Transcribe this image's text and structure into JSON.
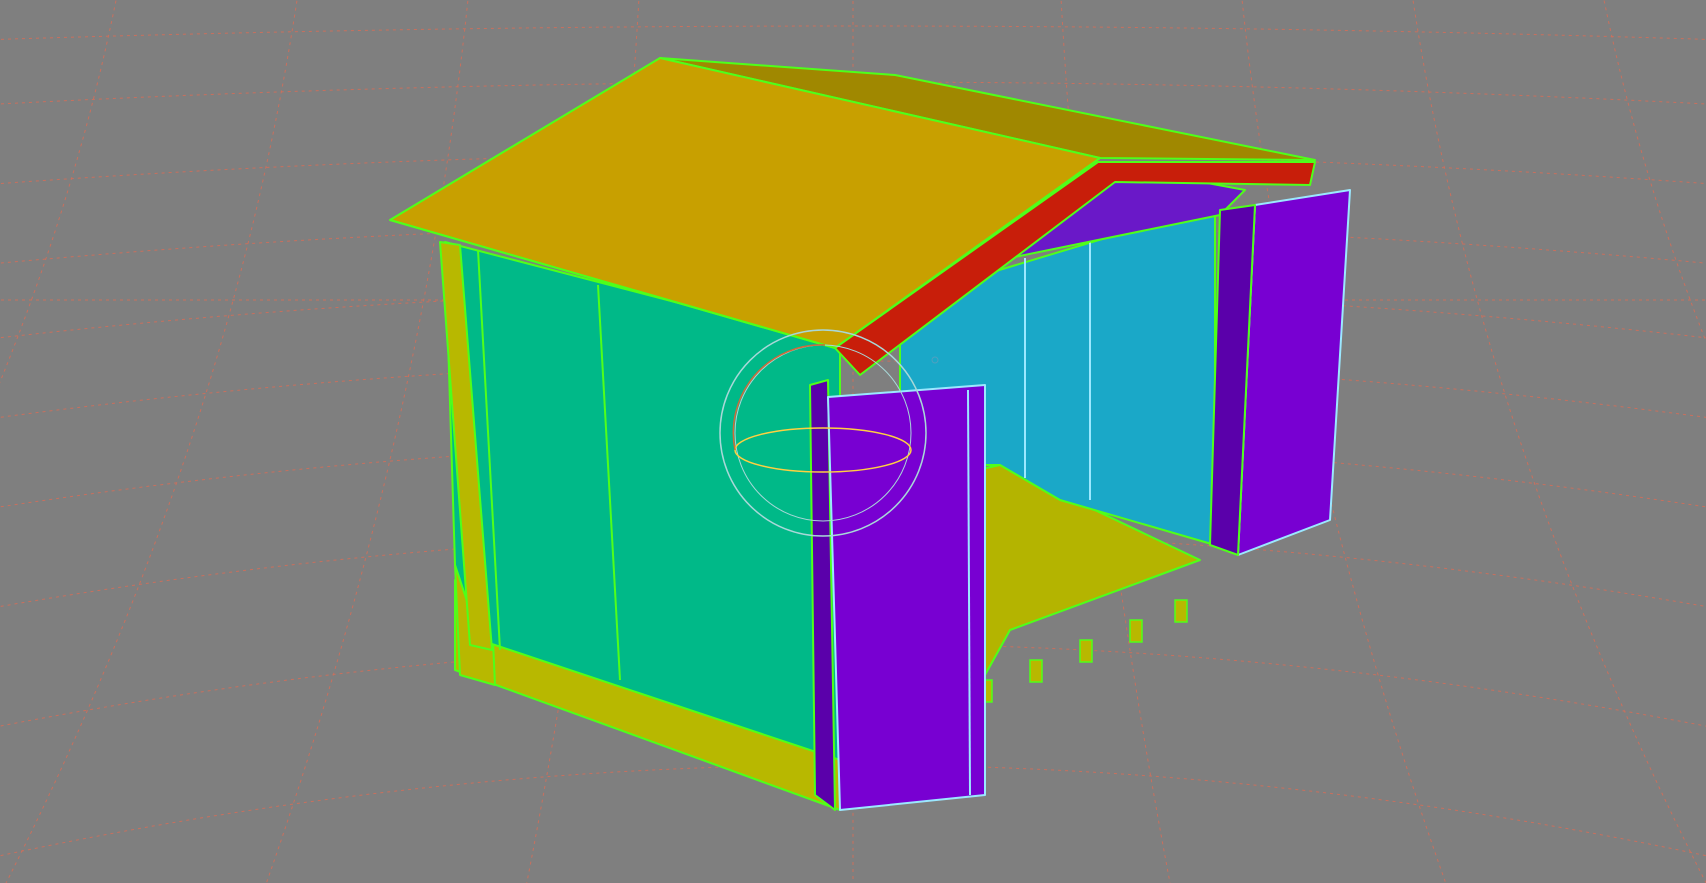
{
  "viewport": {
    "background": "#7f7f7f",
    "grid_color": "#c8705e"
  },
  "model": {
    "colors": {
      "roof": "#c8a000",
      "roof_far": "#a08800",
      "ridge": "#c81e0a",
      "wall_side": "#00b988",
      "wall_back": "#1aa8c8",
      "door": "#7800d2",
      "door_edge": "#5a00aa",
      "floor": "#b4b400",
      "base": "#b8b800",
      "wire": "#4fff1a",
      "wire_alt": "#9be8ff",
      "gable": "#6a18c8"
    },
    "parts": [
      "roof",
      "ridge",
      "side-wall",
      "back-wall",
      "left-door",
      "right-door",
      "floor",
      "base"
    ]
  },
  "gizmo": {
    "type": "rotate",
    "ring_color": "#a8d8d8",
    "axis_color": "#ffd040"
  }
}
